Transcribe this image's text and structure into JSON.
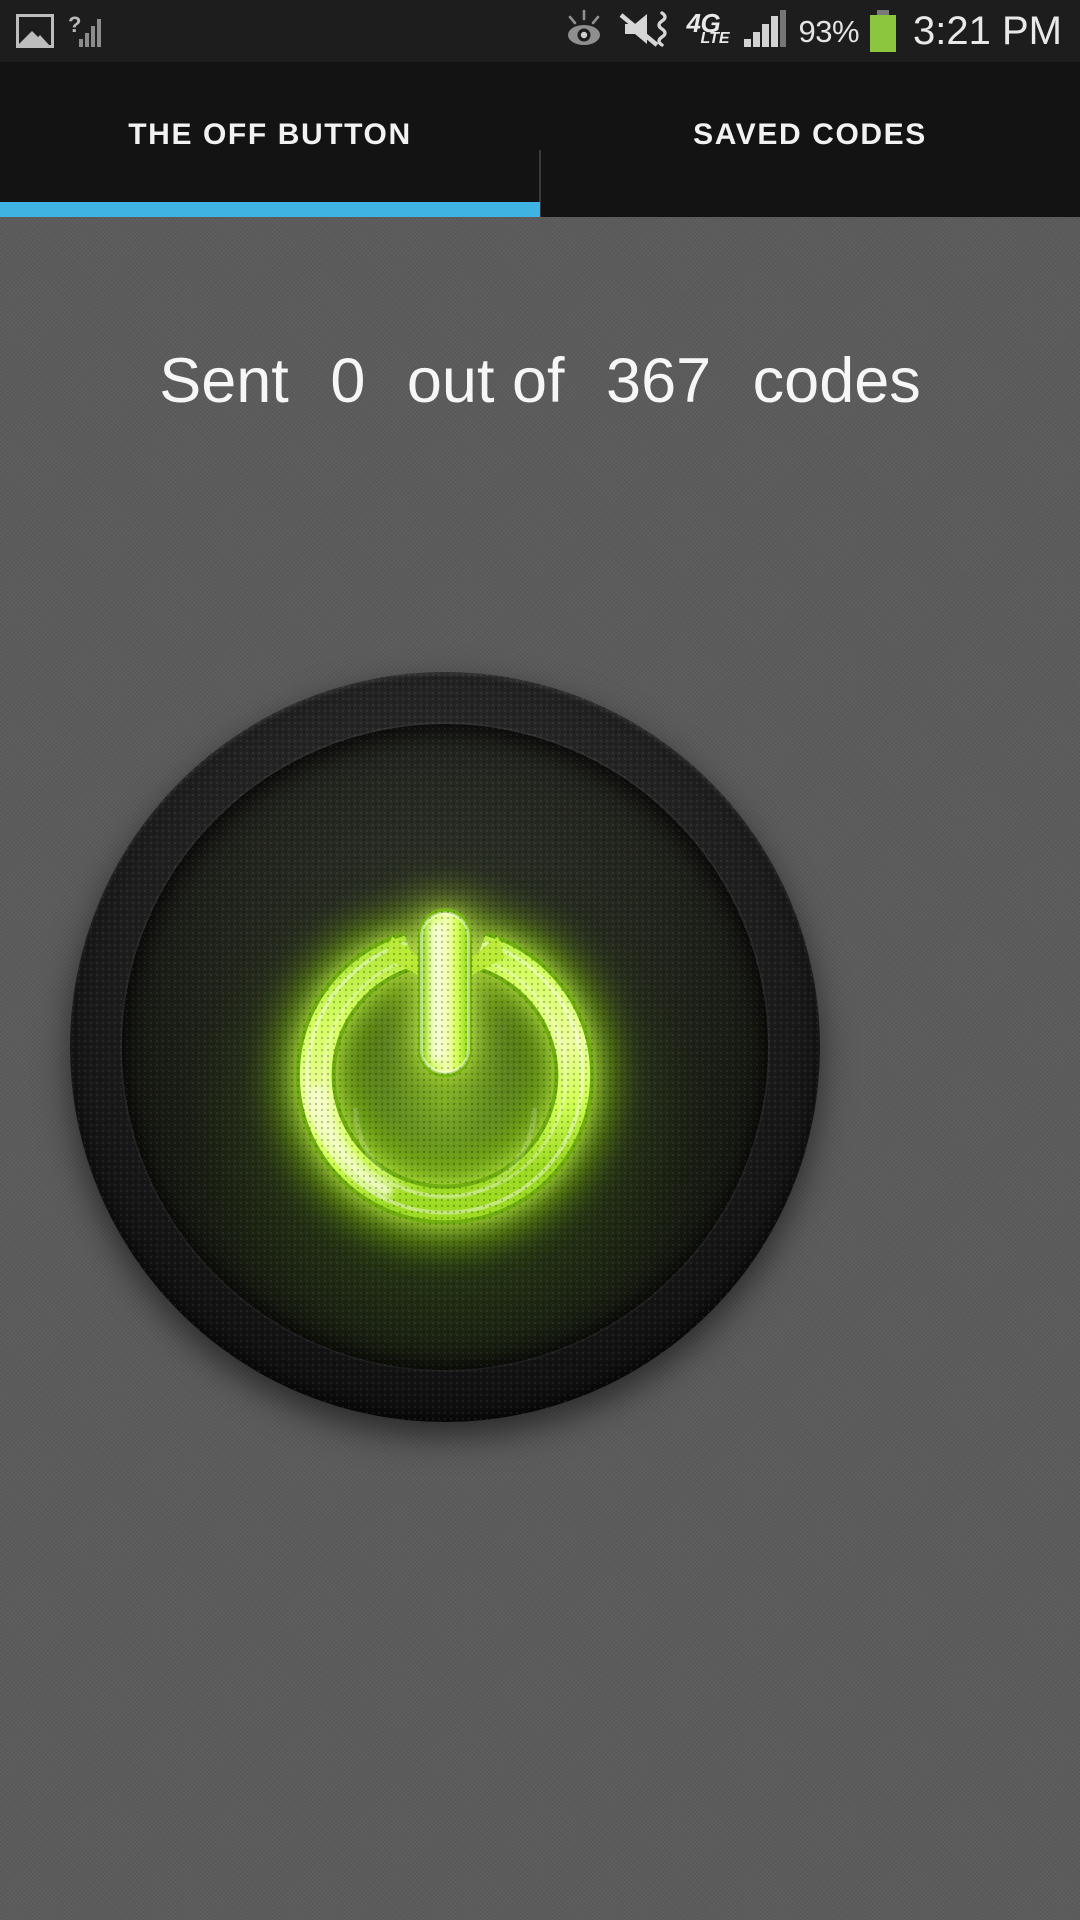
{
  "status_bar": {
    "time": "3:21 PM",
    "battery_percent": "93%",
    "battery_color": "#8cc63e",
    "icons": [
      "gallery-icon",
      "no-sim-signal-icon",
      "smart-stay-eye-icon",
      "sound-mute-vibrate-icon",
      "4g-lte-icon",
      "signal-bars-icon",
      "battery-icon"
    ],
    "network_label_primary": "4G",
    "network_label_secondary": "LTE"
  },
  "tabs": {
    "active_index": 0,
    "indicator_color": "#3fb4e3",
    "items": [
      {
        "label": "THE OFF BUTTON",
        "name": "tab-the-off-button"
      },
      {
        "label": "SAVED CODES",
        "name": "tab-saved-codes"
      }
    ]
  },
  "main": {
    "status": {
      "prefix": "Sent",
      "sent_count": "0",
      "middle": "out of",
      "total_count": "367",
      "suffix": "codes"
    },
    "power_button": {
      "label": "Power",
      "state": "idle",
      "glow_color": "#b6f13a",
      "core_color": "#e8ff8a",
      "rim_color": "#141414"
    }
  }
}
